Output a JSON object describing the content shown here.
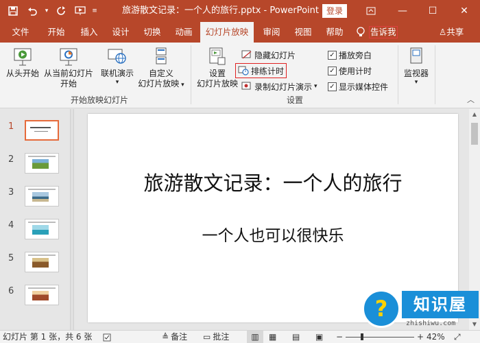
{
  "window": {
    "title": "旅游散文记录：一个人的旅行.pptx - PowerPoint",
    "login_label": "登录"
  },
  "tabs": [
    {
      "label": "文件"
    },
    {
      "label": "开始"
    },
    {
      "label": "插入"
    },
    {
      "label": "设计"
    },
    {
      "label": "切换"
    },
    {
      "label": "动画"
    },
    {
      "label": "幻灯片放映",
      "active": true
    },
    {
      "label": "审阅"
    },
    {
      "label": "视图"
    },
    {
      "label": "帮助"
    }
  ],
  "tellme_label": "告诉我",
  "share_label": "共享",
  "ribbon": {
    "start_group": {
      "label": "开始放映幻灯片",
      "from_beginning": "从头开始",
      "from_current_line1": "从当前幻灯片",
      "from_current_line2": "开始",
      "online_present_line1": "联机演示",
      "custom_line1": "自定义",
      "custom_line2": "幻灯片放映"
    },
    "setup_group": {
      "label": "设置",
      "setup_show_line1": "设置",
      "setup_show_line2": "幻灯片放映",
      "hide_slide": "隐藏幻灯片",
      "rehearse_timings": "排练计时",
      "record_show": "录制幻灯片演示",
      "play_narrations": "播放旁白",
      "use_timings": "使用计时",
      "show_media_controls": "显示媒体控件"
    },
    "monitors_group": {
      "monitor": "监视器"
    }
  },
  "thumbnails": [
    {
      "number": "1",
      "active": true
    },
    {
      "number": "2"
    },
    {
      "number": "3"
    },
    {
      "number": "4"
    },
    {
      "number": "5"
    },
    {
      "number": "6"
    }
  ],
  "slide": {
    "title": "旅游散文记录：一个人的旅行",
    "subtitle": "一个人也可以很快乐"
  },
  "statusbar": {
    "slide_info": "幻灯片 第 1 张，共 6 张",
    "notes": "备注",
    "comments": "批注",
    "zoom": "42%"
  },
  "watermark": {
    "brand": "知识屋",
    "domain": "zhishiwu.com"
  }
}
